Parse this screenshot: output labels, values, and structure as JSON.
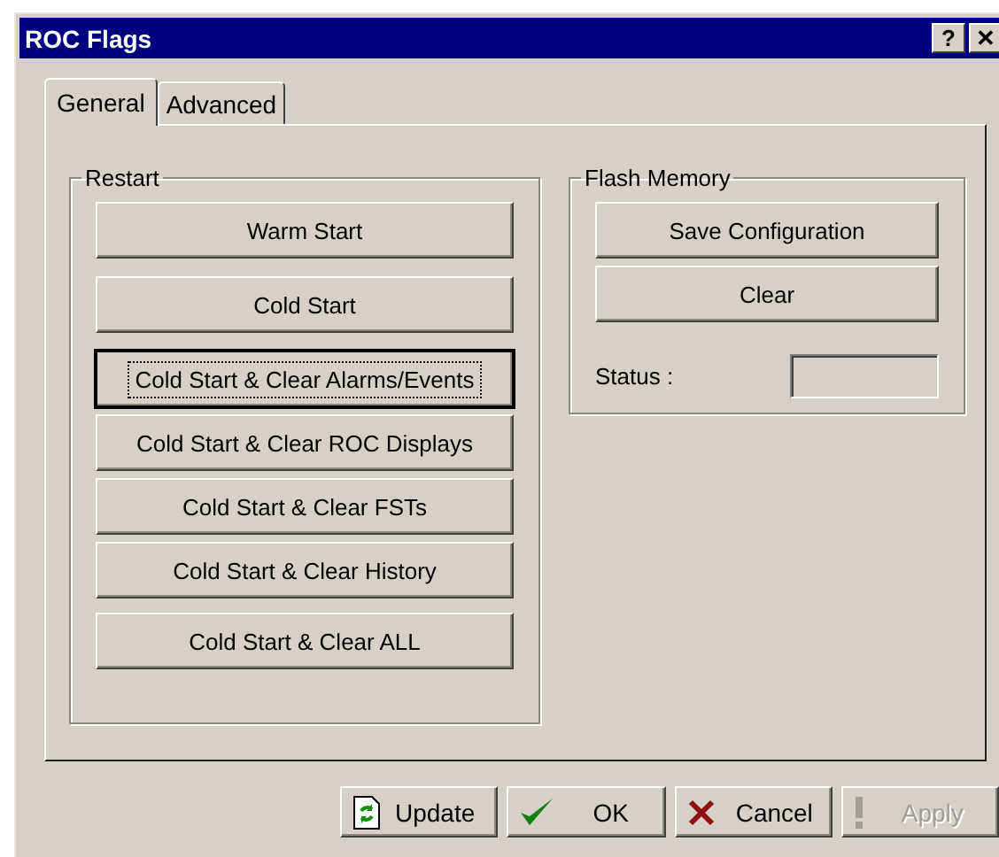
{
  "window": {
    "title": "ROC Flags",
    "buttons": [
      "?",
      "✕"
    ]
  },
  "tabs": [
    {
      "label": "General",
      "selected": true
    },
    {
      "label": "Advanced",
      "selected": false
    }
  ],
  "restart": {
    "title": "Restart",
    "buttons": [
      {
        "label": "Warm Start",
        "focused": false
      },
      {
        "label": "Cold Start",
        "focused": false
      },
      {
        "label": "Cold Start & Clear Alarms/Events",
        "focused": true
      },
      {
        "label": "Cold Start & Clear ROC Displays",
        "focused": false
      },
      {
        "label": "Cold Start & Clear FSTs",
        "focused": false
      },
      {
        "label": "Cold Start & Clear History",
        "focused": false
      },
      {
        "label": "Cold Start & Clear ALL",
        "focused": false
      }
    ]
  },
  "flash": {
    "title": "Flash Memory",
    "buttons": [
      "Save Configuration",
      "Clear"
    ],
    "status_label": "Status :"
  },
  "footer": [
    {
      "kind": "update",
      "label": "Update",
      "disabled": false
    },
    {
      "kind": "ok",
      "label": "OK",
      "disabled": false
    },
    {
      "kind": "cancel",
      "label": "Cancel",
      "disabled": false
    },
    {
      "kind": "apply",
      "label": "Apply",
      "disabled": true
    }
  ]
}
